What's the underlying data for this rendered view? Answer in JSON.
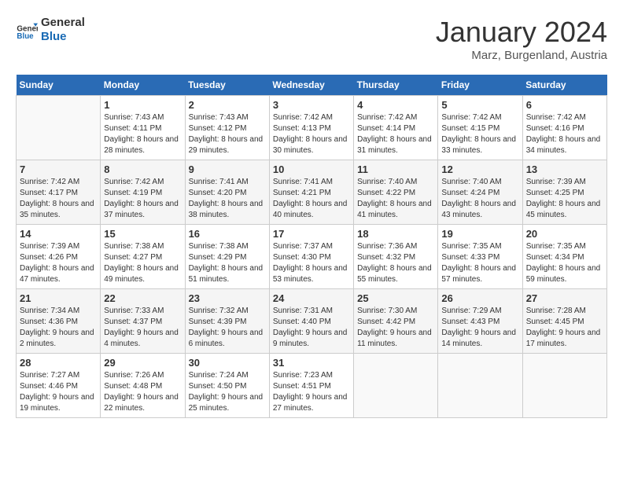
{
  "header": {
    "logo_general": "General",
    "logo_blue": "Blue",
    "month_year": "January 2024",
    "location": "Marz, Burgenland, Austria"
  },
  "days_of_week": [
    "Sunday",
    "Monday",
    "Tuesday",
    "Wednesday",
    "Thursday",
    "Friday",
    "Saturday"
  ],
  "weeks": [
    [
      {
        "day": "",
        "sunrise": "",
        "sunset": "",
        "daylight": ""
      },
      {
        "day": "1",
        "sunrise": "Sunrise: 7:43 AM",
        "sunset": "Sunset: 4:11 PM",
        "daylight": "Daylight: 8 hours and 28 minutes."
      },
      {
        "day": "2",
        "sunrise": "Sunrise: 7:43 AM",
        "sunset": "Sunset: 4:12 PM",
        "daylight": "Daylight: 8 hours and 29 minutes."
      },
      {
        "day": "3",
        "sunrise": "Sunrise: 7:42 AM",
        "sunset": "Sunset: 4:13 PM",
        "daylight": "Daylight: 8 hours and 30 minutes."
      },
      {
        "day": "4",
        "sunrise": "Sunrise: 7:42 AM",
        "sunset": "Sunset: 4:14 PM",
        "daylight": "Daylight: 8 hours and 31 minutes."
      },
      {
        "day": "5",
        "sunrise": "Sunrise: 7:42 AM",
        "sunset": "Sunset: 4:15 PM",
        "daylight": "Daylight: 8 hours and 33 minutes."
      },
      {
        "day": "6",
        "sunrise": "Sunrise: 7:42 AM",
        "sunset": "Sunset: 4:16 PM",
        "daylight": "Daylight: 8 hours and 34 minutes."
      }
    ],
    [
      {
        "day": "7",
        "sunrise": "Sunrise: 7:42 AM",
        "sunset": "Sunset: 4:17 PM",
        "daylight": "Daylight: 8 hours and 35 minutes."
      },
      {
        "day": "8",
        "sunrise": "Sunrise: 7:42 AM",
        "sunset": "Sunset: 4:19 PM",
        "daylight": "Daylight: 8 hours and 37 minutes."
      },
      {
        "day": "9",
        "sunrise": "Sunrise: 7:41 AM",
        "sunset": "Sunset: 4:20 PM",
        "daylight": "Daylight: 8 hours and 38 minutes."
      },
      {
        "day": "10",
        "sunrise": "Sunrise: 7:41 AM",
        "sunset": "Sunset: 4:21 PM",
        "daylight": "Daylight: 8 hours and 40 minutes."
      },
      {
        "day": "11",
        "sunrise": "Sunrise: 7:40 AM",
        "sunset": "Sunset: 4:22 PM",
        "daylight": "Daylight: 8 hours and 41 minutes."
      },
      {
        "day": "12",
        "sunrise": "Sunrise: 7:40 AM",
        "sunset": "Sunset: 4:24 PM",
        "daylight": "Daylight: 8 hours and 43 minutes."
      },
      {
        "day": "13",
        "sunrise": "Sunrise: 7:39 AM",
        "sunset": "Sunset: 4:25 PM",
        "daylight": "Daylight: 8 hours and 45 minutes."
      }
    ],
    [
      {
        "day": "14",
        "sunrise": "Sunrise: 7:39 AM",
        "sunset": "Sunset: 4:26 PM",
        "daylight": "Daylight: 8 hours and 47 minutes."
      },
      {
        "day": "15",
        "sunrise": "Sunrise: 7:38 AM",
        "sunset": "Sunset: 4:27 PM",
        "daylight": "Daylight: 8 hours and 49 minutes."
      },
      {
        "day": "16",
        "sunrise": "Sunrise: 7:38 AM",
        "sunset": "Sunset: 4:29 PM",
        "daylight": "Daylight: 8 hours and 51 minutes."
      },
      {
        "day": "17",
        "sunrise": "Sunrise: 7:37 AM",
        "sunset": "Sunset: 4:30 PM",
        "daylight": "Daylight: 8 hours and 53 minutes."
      },
      {
        "day": "18",
        "sunrise": "Sunrise: 7:36 AM",
        "sunset": "Sunset: 4:32 PM",
        "daylight": "Daylight: 8 hours and 55 minutes."
      },
      {
        "day": "19",
        "sunrise": "Sunrise: 7:35 AM",
        "sunset": "Sunset: 4:33 PM",
        "daylight": "Daylight: 8 hours and 57 minutes."
      },
      {
        "day": "20",
        "sunrise": "Sunrise: 7:35 AM",
        "sunset": "Sunset: 4:34 PM",
        "daylight": "Daylight: 8 hours and 59 minutes."
      }
    ],
    [
      {
        "day": "21",
        "sunrise": "Sunrise: 7:34 AM",
        "sunset": "Sunset: 4:36 PM",
        "daylight": "Daylight: 9 hours and 2 minutes."
      },
      {
        "day": "22",
        "sunrise": "Sunrise: 7:33 AM",
        "sunset": "Sunset: 4:37 PM",
        "daylight": "Daylight: 9 hours and 4 minutes."
      },
      {
        "day": "23",
        "sunrise": "Sunrise: 7:32 AM",
        "sunset": "Sunset: 4:39 PM",
        "daylight": "Daylight: 9 hours and 6 minutes."
      },
      {
        "day": "24",
        "sunrise": "Sunrise: 7:31 AM",
        "sunset": "Sunset: 4:40 PM",
        "daylight": "Daylight: 9 hours and 9 minutes."
      },
      {
        "day": "25",
        "sunrise": "Sunrise: 7:30 AM",
        "sunset": "Sunset: 4:42 PM",
        "daylight": "Daylight: 9 hours and 11 minutes."
      },
      {
        "day": "26",
        "sunrise": "Sunrise: 7:29 AM",
        "sunset": "Sunset: 4:43 PM",
        "daylight": "Daylight: 9 hours and 14 minutes."
      },
      {
        "day": "27",
        "sunrise": "Sunrise: 7:28 AM",
        "sunset": "Sunset: 4:45 PM",
        "daylight": "Daylight: 9 hours and 17 minutes."
      }
    ],
    [
      {
        "day": "28",
        "sunrise": "Sunrise: 7:27 AM",
        "sunset": "Sunset: 4:46 PM",
        "daylight": "Daylight: 9 hours and 19 minutes."
      },
      {
        "day": "29",
        "sunrise": "Sunrise: 7:26 AM",
        "sunset": "Sunset: 4:48 PM",
        "daylight": "Daylight: 9 hours and 22 minutes."
      },
      {
        "day": "30",
        "sunrise": "Sunrise: 7:24 AM",
        "sunset": "Sunset: 4:50 PM",
        "daylight": "Daylight: 9 hours and 25 minutes."
      },
      {
        "day": "31",
        "sunrise": "Sunrise: 7:23 AM",
        "sunset": "Sunset: 4:51 PM",
        "daylight": "Daylight: 9 hours and 27 minutes."
      },
      {
        "day": "",
        "sunrise": "",
        "sunset": "",
        "daylight": ""
      },
      {
        "day": "",
        "sunrise": "",
        "sunset": "",
        "daylight": ""
      },
      {
        "day": "",
        "sunrise": "",
        "sunset": "",
        "daylight": ""
      }
    ]
  ]
}
